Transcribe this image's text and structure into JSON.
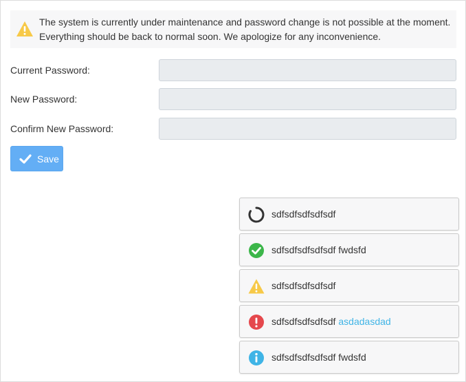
{
  "banner": {
    "icon": "warning-icon",
    "line1": "The system is currently under maintenance and password change is not possible at the moment.",
    "line2": "Everything should be back to normal soon. We apologize for any inconvenience."
  },
  "form": {
    "current_password_label": "Current Password:",
    "new_password_label": "New Password:",
    "confirm_password_label": "Confirm New Password:",
    "current_password_value": "",
    "new_password_value": "",
    "confirm_password_value": ""
  },
  "save_button": {
    "label": "Save",
    "icon": "check-icon"
  },
  "toasts": [
    {
      "icon": "spinner-icon",
      "text": "sdfsdfsdfsdfsdf",
      "link": ""
    },
    {
      "icon": "success-check-icon",
      "text": "sdfsdfsdfsdfsdf fwdsfd",
      "link": ""
    },
    {
      "icon": "warning-icon",
      "text": "sdfsdfsdfsdfsdf",
      "link": ""
    },
    {
      "icon": "error-icon",
      "text": "sdfsdfsdfsdfsdf",
      "link": "asdadasdad"
    },
    {
      "icon": "info-icon",
      "text": "sdfsdfsdfsdfsdf fwdsfd",
      "link": ""
    }
  ],
  "colors": {
    "warning": "#f7c948",
    "success": "#3cb64a",
    "error": "#e5484d",
    "info": "#3fb4e6",
    "spinner": "#333333",
    "button": "#63aef5",
    "link": "#3fb4e6"
  }
}
